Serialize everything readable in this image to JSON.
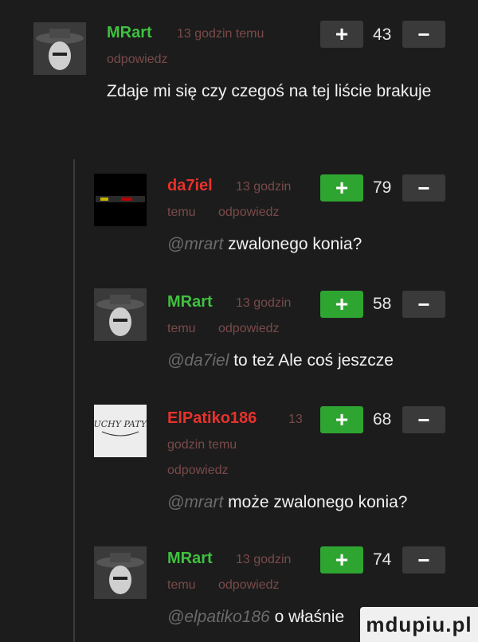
{
  "comments": [
    {
      "author": "MRart",
      "time": "13 godzin temu",
      "reply": "odpowiedz",
      "score": "43",
      "mention": "",
      "text": "Zdaje mi się czy czegoś na tej liście brakuje"
    },
    {
      "author": "da7iel",
      "time_a": "13 godzin",
      "time_b": "temu",
      "reply": "odpowiedz",
      "score": "79",
      "mention": "@mrart",
      "text": "zwalonego konia?"
    },
    {
      "author": "MRart",
      "time_a": "13 godzin",
      "time_b": "temu",
      "reply": "odpowiedz",
      "score": "58",
      "mention": "@da7iel",
      "text": "to też Ale coś jeszcze"
    },
    {
      "author": "ElPatiko186",
      "time_a": "13",
      "time_b": "godzin temu",
      "reply": "odpowiedz",
      "score": "68",
      "mention": "@mrart",
      "text": "może zwalonego konia?"
    },
    {
      "author": "MRart",
      "time_a": "13 godzin",
      "time_b": "temu",
      "reply": "odpowiedz",
      "score": "74",
      "mention": "@elpatiko186",
      "text": "o właśnie"
    }
  ],
  "buttons": {
    "plus": "+",
    "minus": "−"
  },
  "watermark": "mdupiu.pl",
  "avatar_text": {
    "elpatiko": "SUCHY PATYK"
  },
  "colors": {
    "background": "#1c1c1c",
    "green": "#3fc13f",
    "red": "#e8322c",
    "vote_green": "#2fa531",
    "vote_dark": "#3a3a3a"
  }
}
